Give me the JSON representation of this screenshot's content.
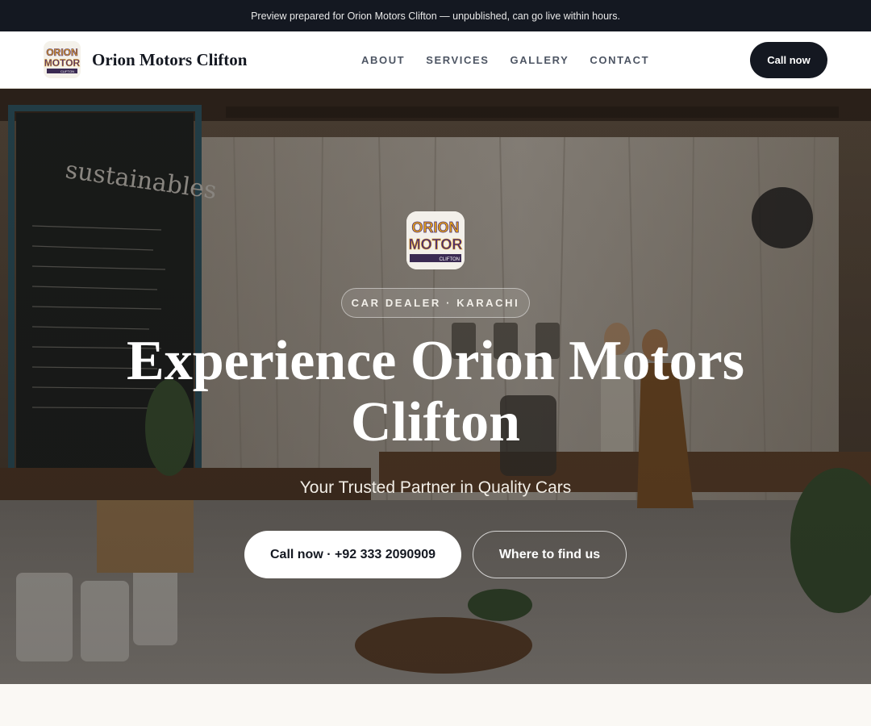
{
  "announcement": "Preview prepared for Orion Motors Clifton — unpublished, can go live within hours.",
  "brand": {
    "name": "Orion Motors Clifton",
    "logo_line1": "ORION",
    "logo_line2": "MOTOR",
    "logo_line3": "CLIFTON"
  },
  "nav": {
    "items": [
      "ABOUT",
      "SERVICES",
      "GALLERY",
      "CONTACT"
    ],
    "call_label": "Call now"
  },
  "hero": {
    "eyebrow": "CAR DEALER · KARACHI",
    "headline": "Experience Orion Motors Clifton",
    "subheadline": "Your Trusted Partner in Quality Cars",
    "primary_cta": "Call now · +92 333 2090909",
    "secondary_cta": "Where to find us",
    "chalkboard_text": "sustainables"
  },
  "colors": {
    "dark": "#141821",
    "logo_gold": "#e8a417",
    "logo_purple": "#4b2d73"
  }
}
